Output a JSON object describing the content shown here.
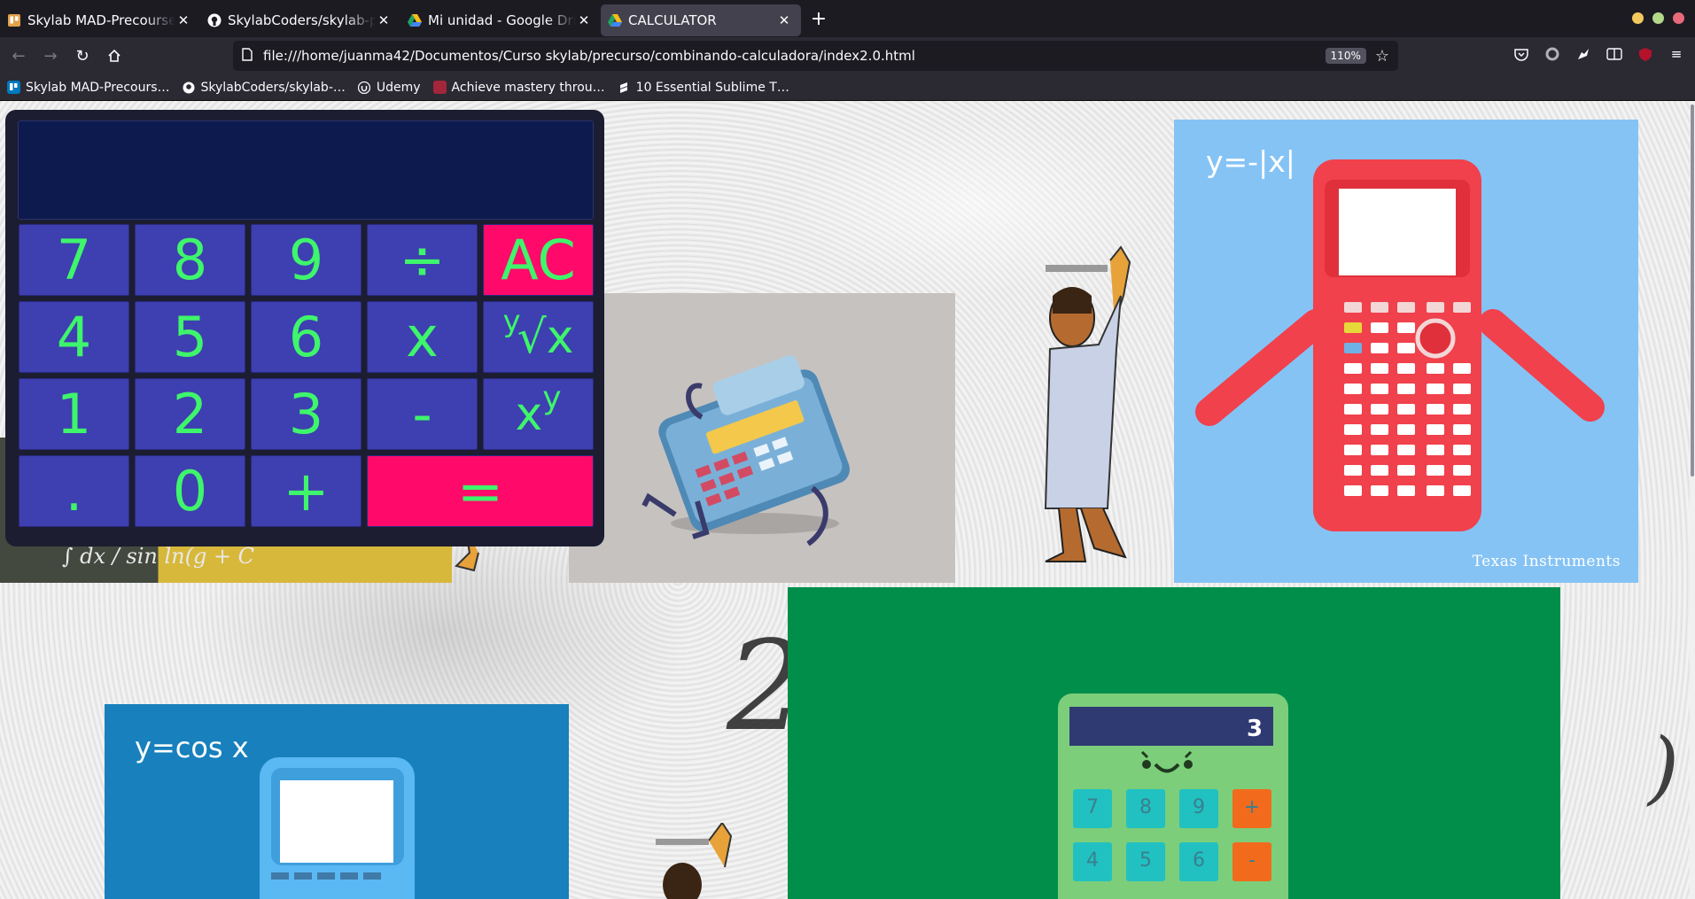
{
  "browser": {
    "tabs": [
      {
        "title": "Skylab MAD-Precourse-2020",
        "icon": "trello-icon",
        "active": false
      },
      {
        "title": "SkylabCoders/skylab-precourse",
        "icon": "github-icon",
        "active": false
      },
      {
        "title": "Mi unidad - Google Drive",
        "icon": "google-drive-icon",
        "active": false
      },
      {
        "title": "CALCULATOR",
        "icon": "google-drive-icon",
        "active": true
      }
    ],
    "url": "file:///home/juanma42/Documentos/Curso skylab/precurso/combinando-calculadora/index2.0.html",
    "zoom": "110%",
    "bookmarks": [
      {
        "label": "Skylab MAD-Precours…",
        "icon": "trello-icon"
      },
      {
        "label": "SkylabCoders/skylab-…",
        "icon": "github-icon"
      },
      {
        "label": "Udemy",
        "icon": "udemy-icon"
      },
      {
        "label": "Achieve mastery throu…",
        "icon": "bookmark-site-icon"
      },
      {
        "label": "10 Essential Sublime T…",
        "icon": "sublime-icon"
      }
    ]
  },
  "calculator": {
    "display": "",
    "keys": {
      "k7": "7",
      "k8": "8",
      "k9": "9",
      "divide": "÷",
      "ac": "AC",
      "k4": "4",
      "k5": "5",
      "k6": "6",
      "multiply": "x",
      "root_pre": "y",
      "root_sym": "√x",
      "k1": "1",
      "k2": "2",
      "k3": "3",
      "minus": "-",
      "power_base": "x",
      "power_exp": "y",
      "dot": ".",
      "k0": "0",
      "plus": "+",
      "equals": "="
    },
    "colors": {
      "body": "#1c1d30",
      "screen": "#0d1a4d",
      "key": "#3e3fb0",
      "key_text": "#3ef56b",
      "accent": "#ff0a6a"
    }
  },
  "images": {
    "ti_label": "y=-|x|",
    "ti_brand": "Texas Instruments",
    "cos_label": "y=cos x",
    "green_display": "3",
    "green_keys": [
      "7",
      "8",
      "9",
      "+",
      "4",
      "5",
      "6",
      "-"
    ],
    "chalk_text": "∫ dx / sin ln(g + C"
  }
}
